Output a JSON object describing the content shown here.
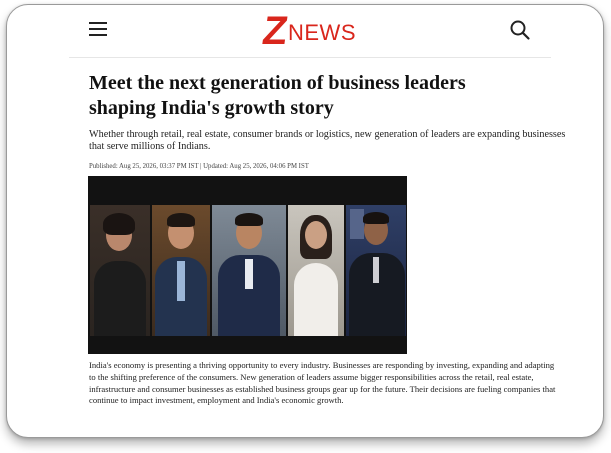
{
  "header": {
    "logo_letter": "Z",
    "logo_text": "NEWS",
    "menu_icon": "hamburger-menu-icon",
    "search_icon": "search-icon",
    "brand_color": "#d9261c"
  },
  "article": {
    "headline": "Meet the next generation of business leaders shaping India's growth story",
    "subheadline": "Whether through retail, real estate, consumer brands or logistics, new generation of leaders are expanding businesses that serve millions of Indians.",
    "meta": "Published: Aug 25, 2026, 03:37 PM IST | Updated: Aug 25, 2026, 04:06 PM IST",
    "body": "India's economy is presenting a thriving opportunity to every industry. Businesses are responding by investing, expanding and adapting to the shifting preference of the consumers. New generation of leaders assume bigger responsibilities across the retail, real estate, infrastructure and consumer businesses as established business groups gear up for the future. Their decisions are fueling companies that continue to impact investment, employment and India's economic growth."
  }
}
